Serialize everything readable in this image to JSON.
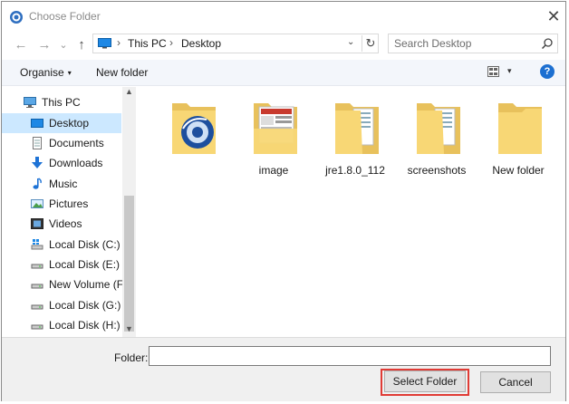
{
  "window": {
    "title": "Choose Folder",
    "close_glyph": "✕"
  },
  "nav": {
    "back_glyph": "←",
    "forward_glyph": "→",
    "history_glyph": "⌄",
    "up_glyph": "↑",
    "breadcrumb": [
      "This PC",
      "Desktop"
    ],
    "breadcrumb_sep": "›",
    "dropdown_glyph": "⌄",
    "refresh_glyph": "↻",
    "search_placeholder": "Search Desktop"
  },
  "toolbar": {
    "organise_label": "Organise",
    "caret": "▾",
    "new_folder_label": "New folder",
    "help_label": "?"
  },
  "sidebar": {
    "items": [
      {
        "label": "This PC",
        "icon": "pc-icon"
      },
      {
        "label": "Desktop",
        "icon": "desktop-icon",
        "selected": true
      },
      {
        "label": "Documents",
        "icon": "documents-icon"
      },
      {
        "label": "Downloads",
        "icon": "downloads-icon"
      },
      {
        "label": "Music",
        "icon": "music-icon"
      },
      {
        "label": "Pictures",
        "icon": "pictures-icon"
      },
      {
        "label": "Videos",
        "icon": "videos-icon"
      },
      {
        "label": "Local Disk (C:)",
        "icon": "windows-drive-icon"
      },
      {
        "label": "Local Disk (E:)",
        "icon": "drive-icon"
      },
      {
        "label": "New Volume (F:)",
        "icon": "drive-icon"
      },
      {
        "label": "Local Disk (G:)",
        "icon": "drive-icon"
      },
      {
        "label": "Local Disk (H:)",
        "icon": "drive-icon"
      }
    ],
    "scroll_up": "▲",
    "scroll_down": "▼"
  },
  "content": {
    "items": [
      {
        "label": "",
        "type": "app-folder"
      },
      {
        "label": "image",
        "type": "image-folder"
      },
      {
        "label": "jre1.8.0_112",
        "type": "doc-folder"
      },
      {
        "label": "screenshots",
        "type": "doc-folder"
      },
      {
        "label": "New folder",
        "type": "empty-folder"
      }
    ]
  },
  "footer": {
    "folder_label": "Folder:",
    "folder_value": "",
    "select_label": "Select Folder",
    "cancel_label": "Cancel"
  },
  "colors": {
    "accent": "#1c6fd1",
    "selection": "#cce8ff",
    "highlight_border": "#e03b35",
    "folder_yellow": "#f8d775"
  }
}
